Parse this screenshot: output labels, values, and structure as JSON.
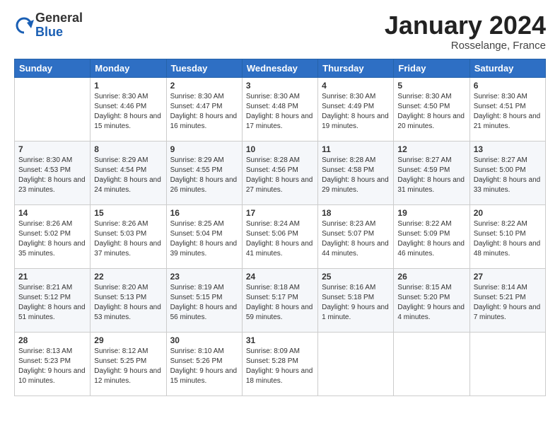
{
  "header": {
    "logo_general": "General",
    "logo_blue": "Blue",
    "month_title": "January 2024",
    "location": "Rosselange, France"
  },
  "weekdays": [
    "Sunday",
    "Monday",
    "Tuesday",
    "Wednesday",
    "Thursday",
    "Friday",
    "Saturday"
  ],
  "weeks": [
    [
      {
        "day": "",
        "sunrise": "",
        "sunset": "",
        "daylight": ""
      },
      {
        "day": "1",
        "sunrise": "Sunrise: 8:30 AM",
        "sunset": "Sunset: 4:46 PM",
        "daylight": "Daylight: 8 hours and 15 minutes."
      },
      {
        "day": "2",
        "sunrise": "Sunrise: 8:30 AM",
        "sunset": "Sunset: 4:47 PM",
        "daylight": "Daylight: 8 hours and 16 minutes."
      },
      {
        "day": "3",
        "sunrise": "Sunrise: 8:30 AM",
        "sunset": "Sunset: 4:48 PM",
        "daylight": "Daylight: 8 hours and 17 minutes."
      },
      {
        "day": "4",
        "sunrise": "Sunrise: 8:30 AM",
        "sunset": "Sunset: 4:49 PM",
        "daylight": "Daylight: 8 hours and 19 minutes."
      },
      {
        "day": "5",
        "sunrise": "Sunrise: 8:30 AM",
        "sunset": "Sunset: 4:50 PM",
        "daylight": "Daylight: 8 hours and 20 minutes."
      },
      {
        "day": "6",
        "sunrise": "Sunrise: 8:30 AM",
        "sunset": "Sunset: 4:51 PM",
        "daylight": "Daylight: 8 hours and 21 minutes."
      }
    ],
    [
      {
        "day": "7",
        "sunrise": "Sunrise: 8:30 AM",
        "sunset": "Sunset: 4:53 PM",
        "daylight": "Daylight: 8 hours and 23 minutes."
      },
      {
        "day": "8",
        "sunrise": "Sunrise: 8:29 AM",
        "sunset": "Sunset: 4:54 PM",
        "daylight": "Daylight: 8 hours and 24 minutes."
      },
      {
        "day": "9",
        "sunrise": "Sunrise: 8:29 AM",
        "sunset": "Sunset: 4:55 PM",
        "daylight": "Daylight: 8 hours and 26 minutes."
      },
      {
        "day": "10",
        "sunrise": "Sunrise: 8:28 AM",
        "sunset": "Sunset: 4:56 PM",
        "daylight": "Daylight: 8 hours and 27 minutes."
      },
      {
        "day": "11",
        "sunrise": "Sunrise: 8:28 AM",
        "sunset": "Sunset: 4:58 PM",
        "daylight": "Daylight: 8 hours and 29 minutes."
      },
      {
        "day": "12",
        "sunrise": "Sunrise: 8:27 AM",
        "sunset": "Sunset: 4:59 PM",
        "daylight": "Daylight: 8 hours and 31 minutes."
      },
      {
        "day": "13",
        "sunrise": "Sunrise: 8:27 AM",
        "sunset": "Sunset: 5:00 PM",
        "daylight": "Daylight: 8 hours and 33 minutes."
      }
    ],
    [
      {
        "day": "14",
        "sunrise": "Sunrise: 8:26 AM",
        "sunset": "Sunset: 5:02 PM",
        "daylight": "Daylight: 8 hours and 35 minutes."
      },
      {
        "day": "15",
        "sunrise": "Sunrise: 8:26 AM",
        "sunset": "Sunset: 5:03 PM",
        "daylight": "Daylight: 8 hours and 37 minutes."
      },
      {
        "day": "16",
        "sunrise": "Sunrise: 8:25 AM",
        "sunset": "Sunset: 5:04 PM",
        "daylight": "Daylight: 8 hours and 39 minutes."
      },
      {
        "day": "17",
        "sunrise": "Sunrise: 8:24 AM",
        "sunset": "Sunset: 5:06 PM",
        "daylight": "Daylight: 8 hours and 41 minutes."
      },
      {
        "day": "18",
        "sunrise": "Sunrise: 8:23 AM",
        "sunset": "Sunset: 5:07 PM",
        "daylight": "Daylight: 8 hours and 44 minutes."
      },
      {
        "day": "19",
        "sunrise": "Sunrise: 8:22 AM",
        "sunset": "Sunset: 5:09 PM",
        "daylight": "Daylight: 8 hours and 46 minutes."
      },
      {
        "day": "20",
        "sunrise": "Sunrise: 8:22 AM",
        "sunset": "Sunset: 5:10 PM",
        "daylight": "Daylight: 8 hours and 48 minutes."
      }
    ],
    [
      {
        "day": "21",
        "sunrise": "Sunrise: 8:21 AM",
        "sunset": "Sunset: 5:12 PM",
        "daylight": "Daylight: 8 hours and 51 minutes."
      },
      {
        "day": "22",
        "sunrise": "Sunrise: 8:20 AM",
        "sunset": "Sunset: 5:13 PM",
        "daylight": "Daylight: 8 hours and 53 minutes."
      },
      {
        "day": "23",
        "sunrise": "Sunrise: 8:19 AM",
        "sunset": "Sunset: 5:15 PM",
        "daylight": "Daylight: 8 hours and 56 minutes."
      },
      {
        "day": "24",
        "sunrise": "Sunrise: 8:18 AM",
        "sunset": "Sunset: 5:17 PM",
        "daylight": "Daylight: 8 hours and 59 minutes."
      },
      {
        "day": "25",
        "sunrise": "Sunrise: 8:16 AM",
        "sunset": "Sunset: 5:18 PM",
        "daylight": "Daylight: 9 hours and 1 minute."
      },
      {
        "day": "26",
        "sunrise": "Sunrise: 8:15 AM",
        "sunset": "Sunset: 5:20 PM",
        "daylight": "Daylight: 9 hours and 4 minutes."
      },
      {
        "day": "27",
        "sunrise": "Sunrise: 8:14 AM",
        "sunset": "Sunset: 5:21 PM",
        "daylight": "Daylight: 9 hours and 7 minutes."
      }
    ],
    [
      {
        "day": "28",
        "sunrise": "Sunrise: 8:13 AM",
        "sunset": "Sunset: 5:23 PM",
        "daylight": "Daylight: 9 hours and 10 minutes."
      },
      {
        "day": "29",
        "sunrise": "Sunrise: 8:12 AM",
        "sunset": "Sunset: 5:25 PM",
        "daylight": "Daylight: 9 hours and 12 minutes."
      },
      {
        "day": "30",
        "sunrise": "Sunrise: 8:10 AM",
        "sunset": "Sunset: 5:26 PM",
        "daylight": "Daylight: 9 hours and 15 minutes."
      },
      {
        "day": "31",
        "sunrise": "Sunrise: 8:09 AM",
        "sunset": "Sunset: 5:28 PM",
        "daylight": "Daylight: 9 hours and 18 minutes."
      },
      {
        "day": "",
        "sunrise": "",
        "sunset": "",
        "daylight": ""
      },
      {
        "day": "",
        "sunrise": "",
        "sunset": "",
        "daylight": ""
      },
      {
        "day": "",
        "sunrise": "",
        "sunset": "",
        "daylight": ""
      }
    ]
  ]
}
